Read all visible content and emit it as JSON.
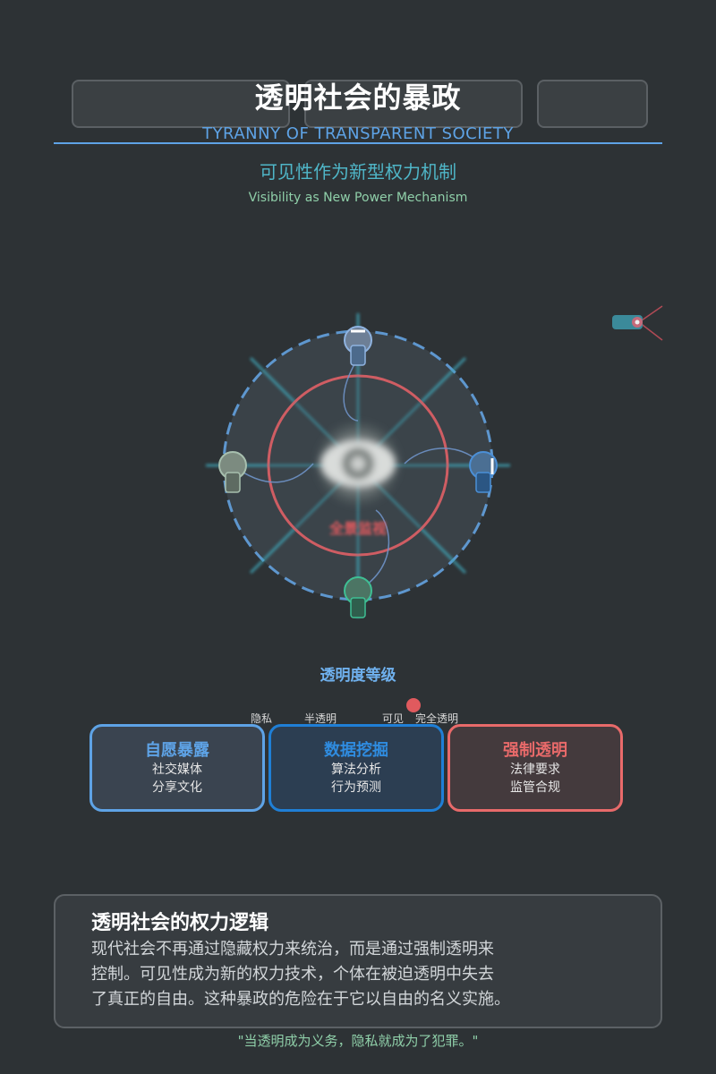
{
  "header": {
    "title": "透明社会的暴政",
    "subtitle_en": "TYRANNY OF TRANSPARENT SOCIETY",
    "tagline_cn": "可见性作为新型权力机制",
    "tagline_en": "Visibility as New Power Mechanism"
  },
  "diagram": {
    "center_label": "全景监视"
  },
  "transparency_scale": {
    "title": "透明度等级",
    "ticks": [
      "隐私",
      "半透明",
      "可见",
      "完全透明"
    ],
    "marker_level": 0.76
  },
  "cards": [
    {
      "title": "自愿暴露",
      "lines": [
        "社交媒体",
        "分享文化"
      ],
      "accent": "#5ea3e6"
    },
    {
      "title": "数据挖掘",
      "lines": [
        "算法分析",
        "行为预测"
      ],
      "accent": "#1f7fd6"
    },
    {
      "title": "强制透明",
      "lines": [
        "法律要求",
        "监管合规"
      ],
      "accent": "#e86a6a"
    }
  ],
  "info": {
    "title": "透明社会的权力逻辑",
    "lines": [
      "现代社会不再通过隐藏权力来统治，而是通过强制透明来",
      "控制。可见性成为新的权力技术，个体在被迫透明中失去",
      "了真正的自由。这种暴政的危险在于它以自由的名义实施。"
    ]
  },
  "quote": "\"当透明成为义务，隐私就成为了犯罪。\"",
  "colors": {
    "background": "#2d3235",
    "blue": "#5ea3e6",
    "deep_blue": "#1f7fd6",
    "red": "#e86a6a",
    "teal": "#4fb6c8",
    "green": "#8fcfa9"
  }
}
